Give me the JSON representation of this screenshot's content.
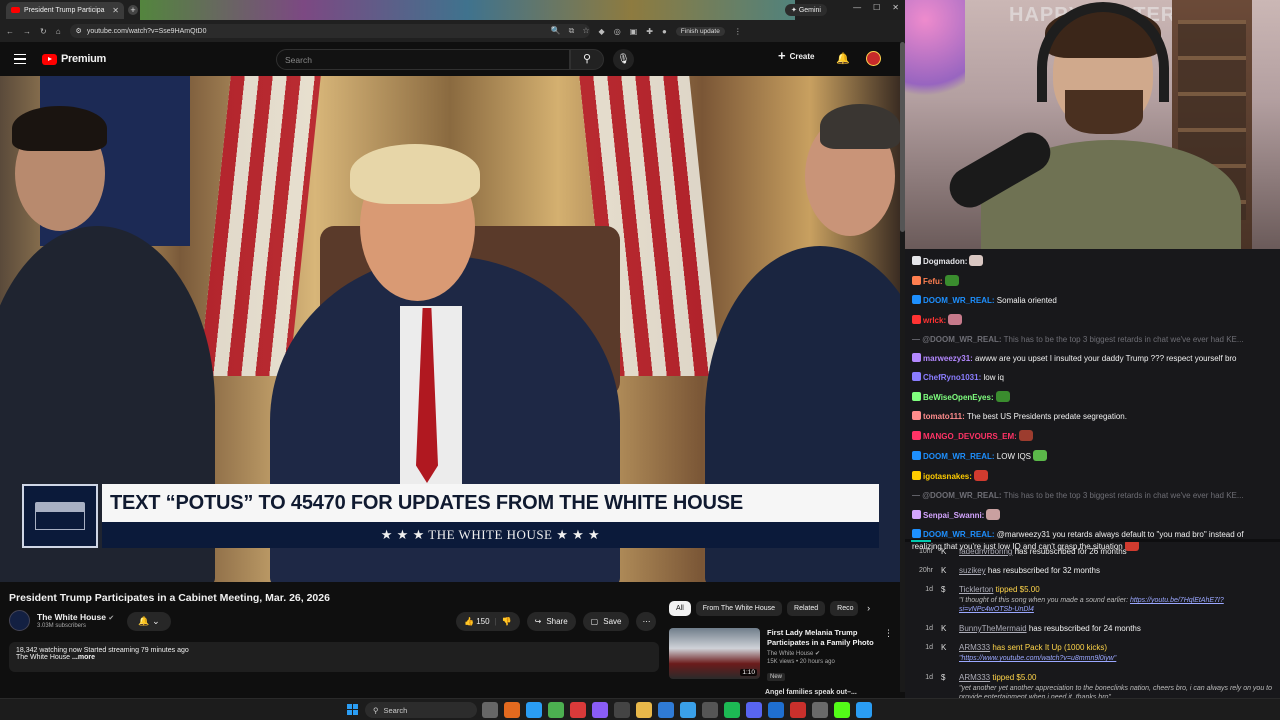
{
  "browser": {
    "tab_title": "President Trump Participa",
    "gemini_label": "Gemini",
    "url": "youtube.com/watch?v=Sse9HAmQtD0",
    "finish_update": "Finish update"
  },
  "youtube": {
    "logo_text": "Premium",
    "search_placeholder": "Search",
    "create_label": "Create"
  },
  "video": {
    "banner_main": "TEXT “POTUS” TO 45470 FOR UPDATES FROM THE WHITE HOUSE",
    "banner_sub": "★ ★ ★   THE WHITE HOUSE   ★ ★ ★",
    "title": "President Trump Participates in a Cabinet Meeting, Mar. 26, 2026",
    "channel_name": "The White House",
    "channel_subs": "3.03M subscribers",
    "likes": "150",
    "share_label": "Share",
    "save_label": "Save",
    "description_line1": "18,342 watching now  Started streaming 79 minutes ago",
    "description_line2": "The White House ",
    "description_more": "...more"
  },
  "recommendations": {
    "chips": [
      "All",
      "From The White House",
      "Related",
      "Reco"
    ],
    "items": [
      {
        "title": "First Lady Melania Trump Participates in a Family Photo",
        "channel": "The White House",
        "meta": "15K views • 20 hours ago",
        "duration": "1:10",
        "badge": "New"
      }
    ],
    "next_title": "Angel families speak out–..."
  },
  "stream": {
    "overlay_text": "HAPPY EASTER",
    "chat": [
      {
        "user": "Dogmadon:",
        "text": "",
        "color": "#e6e6ea",
        "emote": "#d9c7c2"
      },
      {
        "user": "Fefu:",
        "text": "",
        "color": "#ff7f50",
        "emote": "#3a8c2e"
      },
      {
        "user": "DOOM_WR_REAL:",
        "text": " Somalia oriented",
        "color": "#1e90ff",
        "emote": ""
      },
      {
        "user": "wrlck:",
        "text": "",
        "color": "#ff3333",
        "emote": "#c77a8b"
      },
      {
        "user": "— @DOOM_WR_REAL:",
        "text": " This has to be the top 3 biggest retards in chat we've ever had KE...",
        "color": "#6e6e75",
        "emote": "",
        "muted": true
      },
      {
        "user": "marweezy31:",
        "text": " awww are you upset I insulted your daddy Trump ??? respect yourself bro",
        "color": "#b388ff",
        "emote": ""
      },
      {
        "user": "ChefRyno1031:",
        "text": " low iq",
        "color": "#8a7dff",
        "emote": ""
      },
      {
        "user": "BeWiseOpenEyes:",
        "text": "",
        "color": "#7fff7f",
        "emote": "#3a8c2e"
      },
      {
        "user": "tomato111:",
        "text": " The best US Presidents predate segregation.",
        "color": "#ff8c8c",
        "emote": ""
      },
      {
        "user": "MANGO_DEVOURS_EM:",
        "text": "",
        "color": "#ff3366",
        "emote": "#9c3c2e"
      },
      {
        "user": "DOOM_WR_REAL:",
        "text": " LOW IQS",
        "color": "#1e90ff",
        "emote": "#5bb84a"
      },
      {
        "user": "igotasnakes:",
        "text": "",
        "color": "#ffcc00",
        "emote": "#d13b2f"
      },
      {
        "user": "— @DOOM_WR_REAL:",
        "text": " This has to be the top 3 biggest retards in chat we've ever had KE...",
        "color": "#6e6e75",
        "emote": "",
        "muted": true
      },
      {
        "user": "Senpai_Swanni:",
        "text": "",
        "color": "#d4a5ff",
        "emote": "#c9a0a0"
      },
      {
        "user": "DOOM_WR_REAL:",
        "text": " @marweezy31 you retards always default to \"you mad bro\" instead of realizing that you're just low IQ and can't grasp the situation",
        "color": "#1e90ff",
        "emote": "#d13b2f",
        "wrap": true
      }
    ],
    "events": [
      {
        "time": "10hr",
        "who": "fadednvrboring",
        "text": " has resubscribed for 26 months",
        "quote": "",
        "link": ""
      },
      {
        "time": "20hr",
        "who": "suzikey",
        "text": " has resubscribed for 32 months",
        "quote": "",
        "link": ""
      },
      {
        "time": "1d",
        "who": "Ticklerton",
        "text": " tipped $5.00",
        "quote": "\"I thought of this song when you made a sound earlier: ",
        "link": "https://youtu.be/7HqlEtAhE7I?si=vNPc4wOTSb-UnDl4"
      },
      {
        "time": "1d",
        "who": "BunnyTheMermaid",
        "text": " has resubscribed for 24 months",
        "quote": "",
        "link": ""
      },
      {
        "time": "1d",
        "who": "ARM333",
        "text": " has sent Pack It Up (1000 kicks)",
        "quote": "",
        "link": "\"https://www.youtube.com/watch?v=u8mmn9l0iyw\""
      },
      {
        "time": "1d",
        "who": "ARM333",
        "text": " tipped $5.00",
        "quote": "\"yet another yet another appreciation to the boneclinks nation, cheers bro, i can always rely on you to provide entertainment when i need it, thanks bro\"",
        "link": ""
      }
    ]
  },
  "taskbar": {
    "search_label": "Search"
  },
  "colors": {
    "yt_red": "#ff0000",
    "chat_bg": "#18181b",
    "banner_navy": "#0b1a3a"
  }
}
